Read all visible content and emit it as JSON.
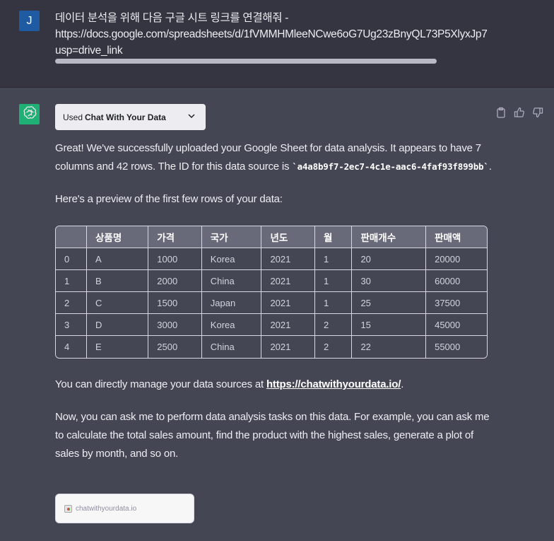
{
  "user": {
    "avatar_initial": "J",
    "message_lines": [
      "데이터 분석을 위해 다음 구글 시트 링크를 연결해줘 -",
      "https://docs.google.com/spreadsheets/d/1fVMMHMleeNCwe6oG7Ug23zBnyQL73P5XlyxJp7",
      "usp=drive_link"
    ]
  },
  "assistant": {
    "plugin": {
      "used_label": "Used",
      "name": "Chat With Your Data"
    },
    "actions": [
      "copy-icon",
      "thumbs-up-icon",
      "thumbs-down-icon"
    ],
    "intro_text": "Great! We've successfully uploaded your Google Sheet for data analysis. It appears to have 7 columns and 42 rows. The ID for this data source is ",
    "data_source_id": "`a4a8b9f7-2ec7-4c1e-aac6-4faf93f899bb`",
    "intro_end": ".",
    "preview_text": "Here's a preview of the first few rows of your data:",
    "table": {
      "headers": [
        "",
        "상품명",
        "가격",
        "국가",
        "년도",
        "월",
        "판매개수",
        "판매액"
      ],
      "rows": [
        [
          "0",
          "A",
          "1000",
          "Korea",
          "2021",
          "1",
          "20",
          "20000"
        ],
        [
          "1",
          "B",
          "2000",
          "China",
          "2021",
          "1",
          "30",
          "60000"
        ],
        [
          "2",
          "C",
          "1500",
          "Japan",
          "2021",
          "1",
          "25",
          "37500"
        ],
        [
          "3",
          "D",
          "3000",
          "Korea",
          "2021",
          "2",
          "15",
          "45000"
        ],
        [
          "4",
          "E",
          "2500",
          "China",
          "2021",
          "2",
          "22",
          "55000"
        ]
      ]
    },
    "manage_text": "You can directly manage your data sources at ",
    "manage_link": "https://chatwithyourdata.io/",
    "manage_end": ".",
    "next_text": "Now, you can ask me to perform data analysis tasks on this data. For example, you can ask me to calculate the total sales amount, find the product with the highest sales, generate a plot of sales by month, and so on.",
    "link_card": {
      "domain": "chatwithyourdata.io"
    }
  },
  "colors": {
    "user_bg": "#343541",
    "assistant_bg": "#444654",
    "user_avatar": "#1f5ba3",
    "bot_avatar": "#19c37d"
  }
}
